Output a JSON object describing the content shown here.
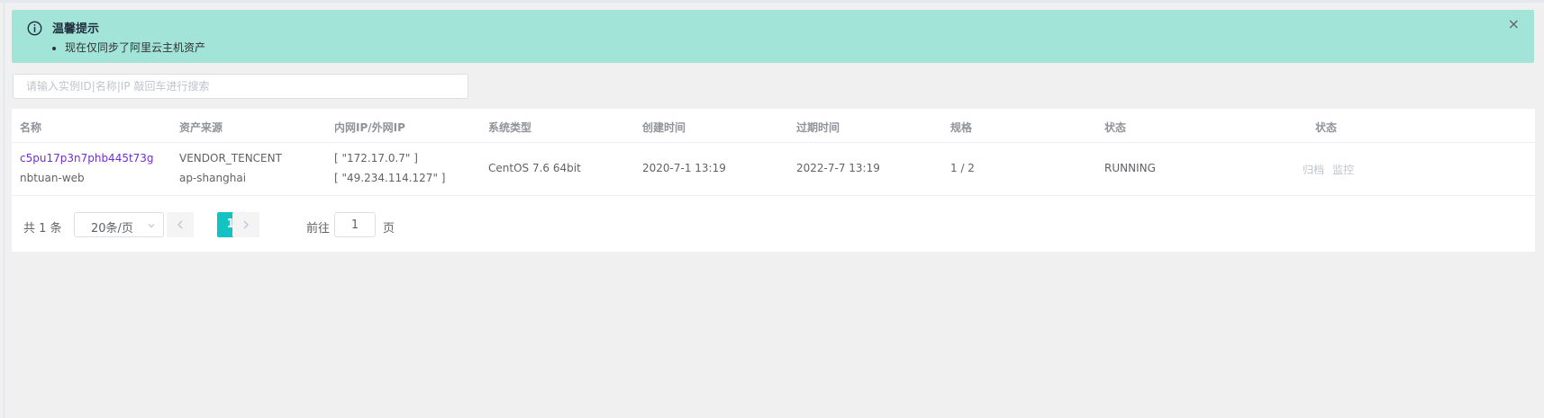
{
  "alert": {
    "title": "温馨提示",
    "items": [
      "现在仅同步了阿里云主机资产"
    ],
    "close_symbol": "×",
    "background": "#a3e4d9"
  },
  "search": {
    "placeholder": "请输入实例ID|名称|IP 敲回车进行搜索",
    "value": ""
  },
  "table": {
    "headers": [
      "名称",
      "资产来源",
      "内网IP/外网IP",
      "系统类型",
      "创建时间",
      "过期时间",
      "规格",
      "状态",
      "状态"
    ],
    "rows": [
      {
        "instance_id": "c5pu17p3n7phb445t73g",
        "name": "nbtuan-web",
        "vendor": "VENDOR_TENCENT",
        "region": "ap-shanghai",
        "private_ip": "[ \"172.17.0.7\" ]",
        "public_ip": "[ \"49.234.114.127\" ]",
        "os": "CentOS 7.6 64bit",
        "created": "2020-7-1 13:19",
        "expires": "2022-7-7 13:19",
        "spec": "1 / 2",
        "status": "RUNNING",
        "actions": [
          "归档",
          "监控"
        ]
      }
    ]
  },
  "pagination": {
    "total_label": "共 1 条",
    "page_size": "20条/页",
    "current_page": "1",
    "goto_label": "前往",
    "goto_value": "1",
    "goto_unit": "页"
  },
  "colors": {
    "accent": "#13c2c2",
    "link": "#722ed1"
  }
}
